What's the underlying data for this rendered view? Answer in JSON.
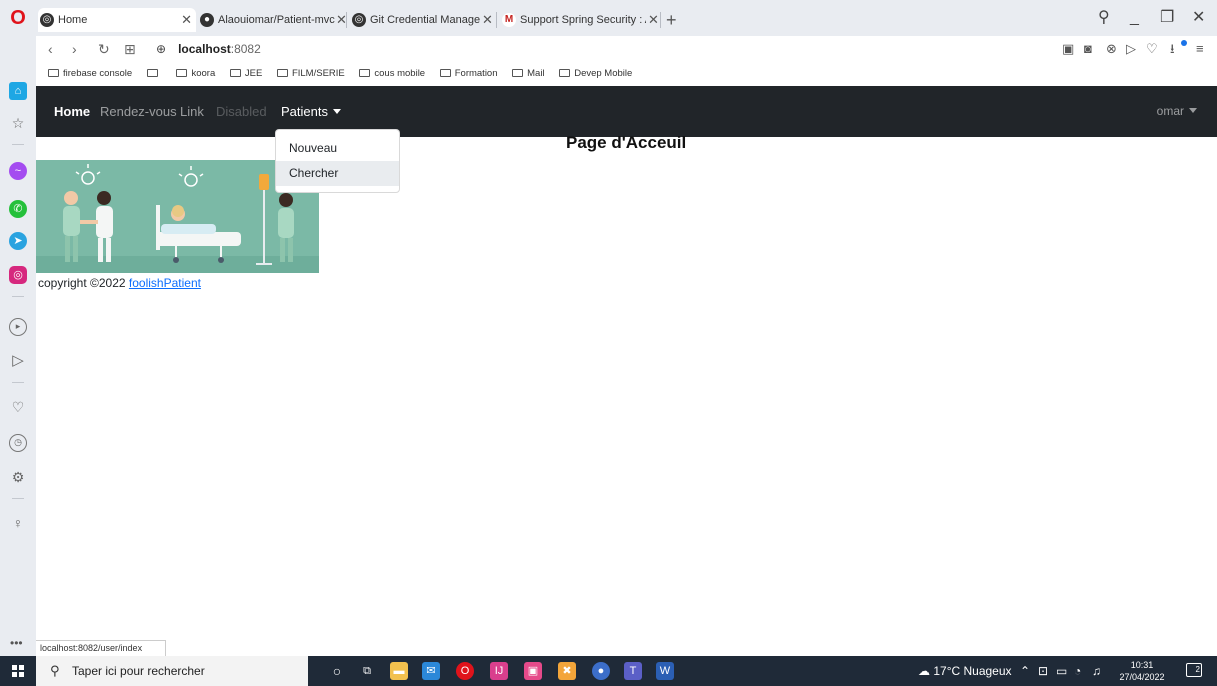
{
  "browser": {
    "tabs": [
      {
        "title": "Home",
        "active": true
      },
      {
        "title": "Alaouiomar/Patient-mvc",
        "active": false
      },
      {
        "title": "Git Credential Manager - A",
        "active": false
      },
      {
        "title": "Support Spring Security : A",
        "active": false
      }
    ],
    "new_tab": "+",
    "url_host": "localhost",
    "url_port": ":8082",
    "bookmarks": [
      "firebase console",
      "",
      "koora",
      "JEE",
      "FILM/SERIE",
      "cous mobile",
      "Formation",
      "Mail",
      "Devep Mobile"
    ],
    "status_url": "localhost:8082/user/index"
  },
  "navbar": {
    "brand": "Home",
    "links": [
      "Rendez-vous",
      "Link",
      "Disabled"
    ],
    "patients_menu": "Patients",
    "user_menu": "omar",
    "dropdown_items": [
      "Nouveau",
      "Chercher"
    ]
  },
  "main": {
    "title": "Page d'Acceuil",
    "copyright_prefix": "copyright ©2022 ",
    "copyright_link": "foolishPatient"
  },
  "taskbar": {
    "search_placeholder": "Taper ici pour rechercher",
    "weather": "17°C Nuageux",
    "time": "10:31",
    "date": "27/04/2022",
    "notifications": "2"
  },
  "colors": {
    "navbar_bg": "#212529",
    "hero_bg": "#7bb9a6",
    "link": "#0d6efd",
    "opera_red": "#e0131b"
  }
}
